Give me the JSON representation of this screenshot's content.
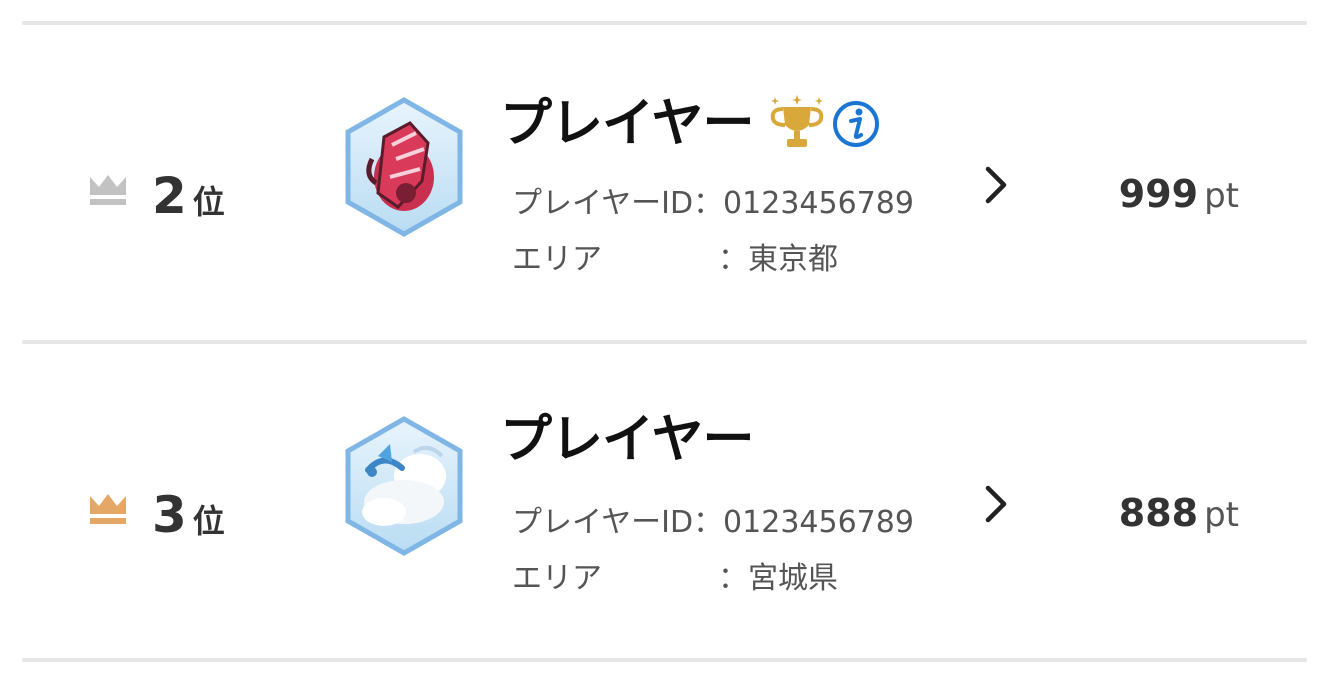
{
  "rows": [
    {
      "rank": "2",
      "rank_suffix": "位",
      "crown_icon": "silver-crown-icon",
      "crown_color": "#c2c2c2",
      "avatar_icon": "pokemon-avatar-red-icon",
      "name": "プレイヤー",
      "has_trophy": true,
      "trophy_icon": "gold-trophy-icon",
      "info_icon": "info-icon",
      "id_label": "プレイヤーID",
      "id_value": "：0123456789",
      "area_label": "エリア",
      "area_value": "：東京都",
      "points": "999",
      "points_unit": "pt"
    },
    {
      "rank": "3",
      "rank_suffix": "位",
      "crown_icon": "bronze-crown-icon",
      "crown_color": "#e5a766",
      "avatar_icon": "pokemon-avatar-white-bird-icon",
      "name": "プレイヤー",
      "has_trophy": false,
      "id_label": "プレイヤーID",
      "id_value": "：0123456789",
      "area_label": "エリア",
      "area_value": "：宮城県",
      "points": "888",
      "points_unit": "pt"
    }
  ],
  "colors": {
    "divider": "#e6e6e6",
    "info_blue": "#1a76d2",
    "trophy_gold": "#d8a93a",
    "avatar_border": "#7fb6e6"
  }
}
